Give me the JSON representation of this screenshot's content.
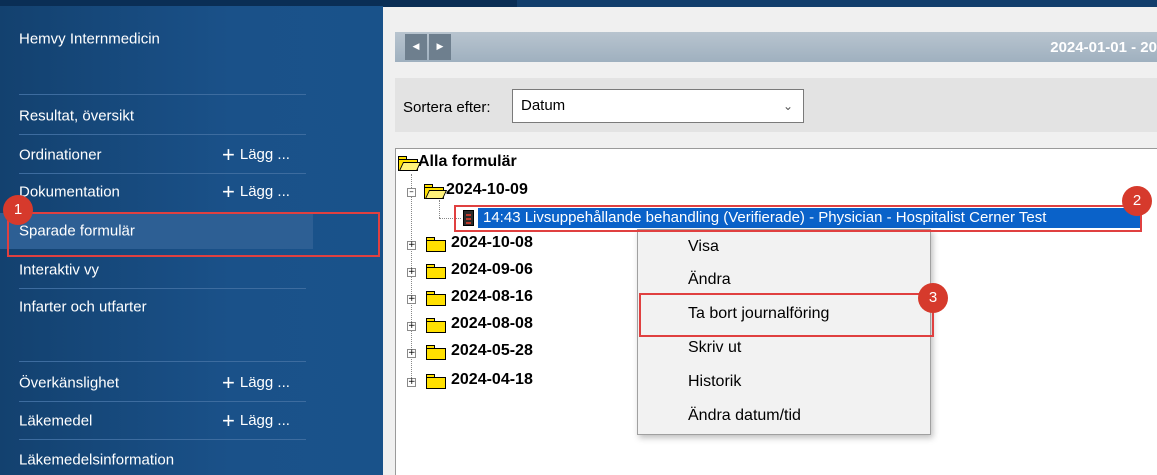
{
  "sidebar": {
    "items": [
      {
        "label": "Hemvy Internmedicin"
      },
      {
        "label": "Resultat, översikt"
      },
      {
        "label": "Ordinationer",
        "action": "Lägg ..."
      },
      {
        "label": "Dokumentation",
        "action": "Lägg ..."
      },
      {
        "label": "Sparade formulär",
        "selected": true
      },
      {
        "label": "Interaktiv vy"
      },
      {
        "label": "Infarter och utfarter"
      },
      {
        "label": "Överkänslighet",
        "action": "Lägg ..."
      },
      {
        "label": "Läkemedel",
        "action": "Lägg ..."
      },
      {
        "label": "Läkemedelsinformation"
      }
    ]
  },
  "content": {
    "date_range": "2024-01-01 - 20",
    "sort": {
      "label": "Sortera efter:",
      "value": "Datum"
    },
    "tree": {
      "root": "Alla formulär",
      "expanded_folder": "2024-10-09",
      "selected_document": "14:43  Livsuppehållande behandling (Verifierade) - Physician - Hospitalist Cerner Test",
      "folders": [
        "2024-10-08",
        "2024-09-06",
        "2024-08-16",
        "2024-08-08",
        "2024-05-28",
        "2024-04-18"
      ]
    },
    "context_menu": {
      "items": [
        "Visa",
        "Ändra",
        "Ta bort journalföring",
        "Skriv ut",
        "Historik",
        "Ändra datum/tid"
      ]
    }
  },
  "callouts": [
    "1",
    "2",
    "3"
  ],
  "colors": {
    "sidebar_bg": "#1a5189",
    "selection_blue": "#0a62c9",
    "callout_red": "#d63a2c"
  }
}
